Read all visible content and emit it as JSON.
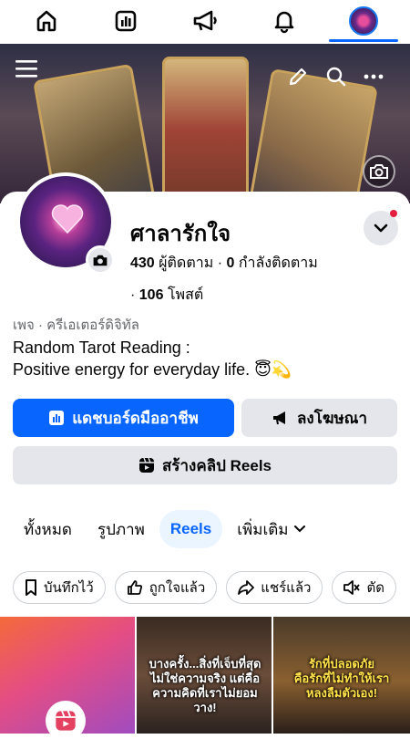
{
  "nav": {
    "items": [
      "home-icon",
      "dashboard-icon",
      "megaphone-icon",
      "bell-icon",
      "profile-avatar"
    ],
    "active": 4
  },
  "profile": {
    "name": "ศาลารักใจ",
    "followers_count": "430",
    "followers_label": "ผู้ติดตาม",
    "following_count": "0",
    "following_label": "กำลังติดตาม",
    "posts_count": "106",
    "posts_label": "โพสต์",
    "category": "เพจ · ครีเอเตอร์ดิจิทัล",
    "bio_line1": "Random Tarot Reading :",
    "bio_line2": "Positive energy for everyday life. 😇💫"
  },
  "buttons": {
    "dashboard": "แดชบอร์ดมืออาชีพ",
    "ads": "ลงโฆษณา",
    "create_reels": "สร้างคลิป Reels"
  },
  "tabs": [
    {
      "label": "ทั้งหมด"
    },
    {
      "label": "รูปภาพ"
    },
    {
      "label": "Reels"
    },
    {
      "label": "เพิ่มเติม"
    }
  ],
  "selected_tab": "Reels",
  "chips": [
    {
      "label": "บันทึกไว้",
      "icon": "bookmark-icon"
    },
    {
      "label": "ถูกใจแล้ว",
      "icon": "thumbs-up-icon"
    },
    {
      "label": "แชร์แล้ว",
      "icon": "share-icon"
    },
    {
      "label": "ตัด",
      "icon": "mute-icon"
    }
  ],
  "thumbnails": [
    {
      "caption": ""
    },
    {
      "caption_a": "บางครั้ง...สิ่งที่เจ็บที่สุด",
      "caption_b": "ไม่ใช่ความจริง",
      "caption_c": "แต่คือ",
      "caption_d": "ความคิดที่เราไม่ยอมวาง!"
    },
    {
      "caption_a": "รักที่ปลอดภัย",
      "caption_b": "คือรักที่ไม่ทำให้เรา",
      "caption_c": "หลงลืมตัวเอง!"
    }
  ],
  "colors": {
    "accent": "#0866ff",
    "chip_border": "#ccd0d5",
    "button_gray": "#e4e6eb",
    "notification": "#e41e3f"
  }
}
